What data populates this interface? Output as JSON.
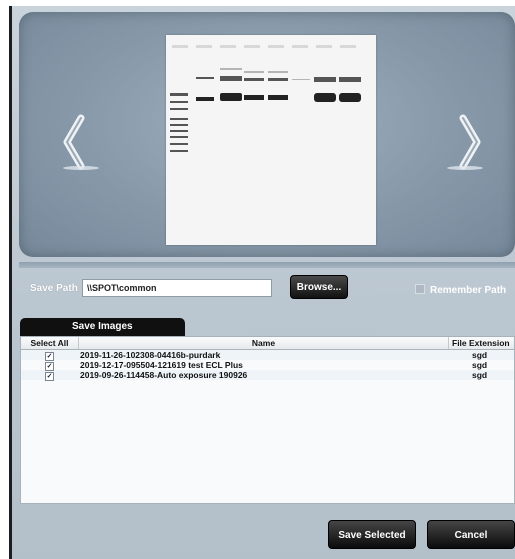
{
  "viewer": {
    "prev_icon": "chevron-left-icon",
    "next_icon": "chevron-right-icon",
    "image_desc": "gel-image"
  },
  "save_path": {
    "label": "Save Path",
    "value": "\\\\SPOT\\common",
    "browse_label": "Browse...",
    "remember_label": "Remember Path",
    "remember_checked": false
  },
  "tab": {
    "label": "Save Images"
  },
  "table": {
    "columns": [
      "Select All",
      "Name",
      "File Extension"
    ],
    "rows": [
      {
        "checked": true,
        "name": "2019-11-26-102308-04416b-purdark",
        "ext": "sgd"
      },
      {
        "checked": true,
        "name": "2019-12-17-095504-121619 test ECL Plus",
        "ext": "sgd"
      },
      {
        "checked": true,
        "name": "2019-09-26-114458-Auto exposure 190926",
        "ext": "sgd"
      }
    ]
  },
  "footer": {
    "save_selected": "Save Selected",
    "cancel": "Cancel"
  }
}
